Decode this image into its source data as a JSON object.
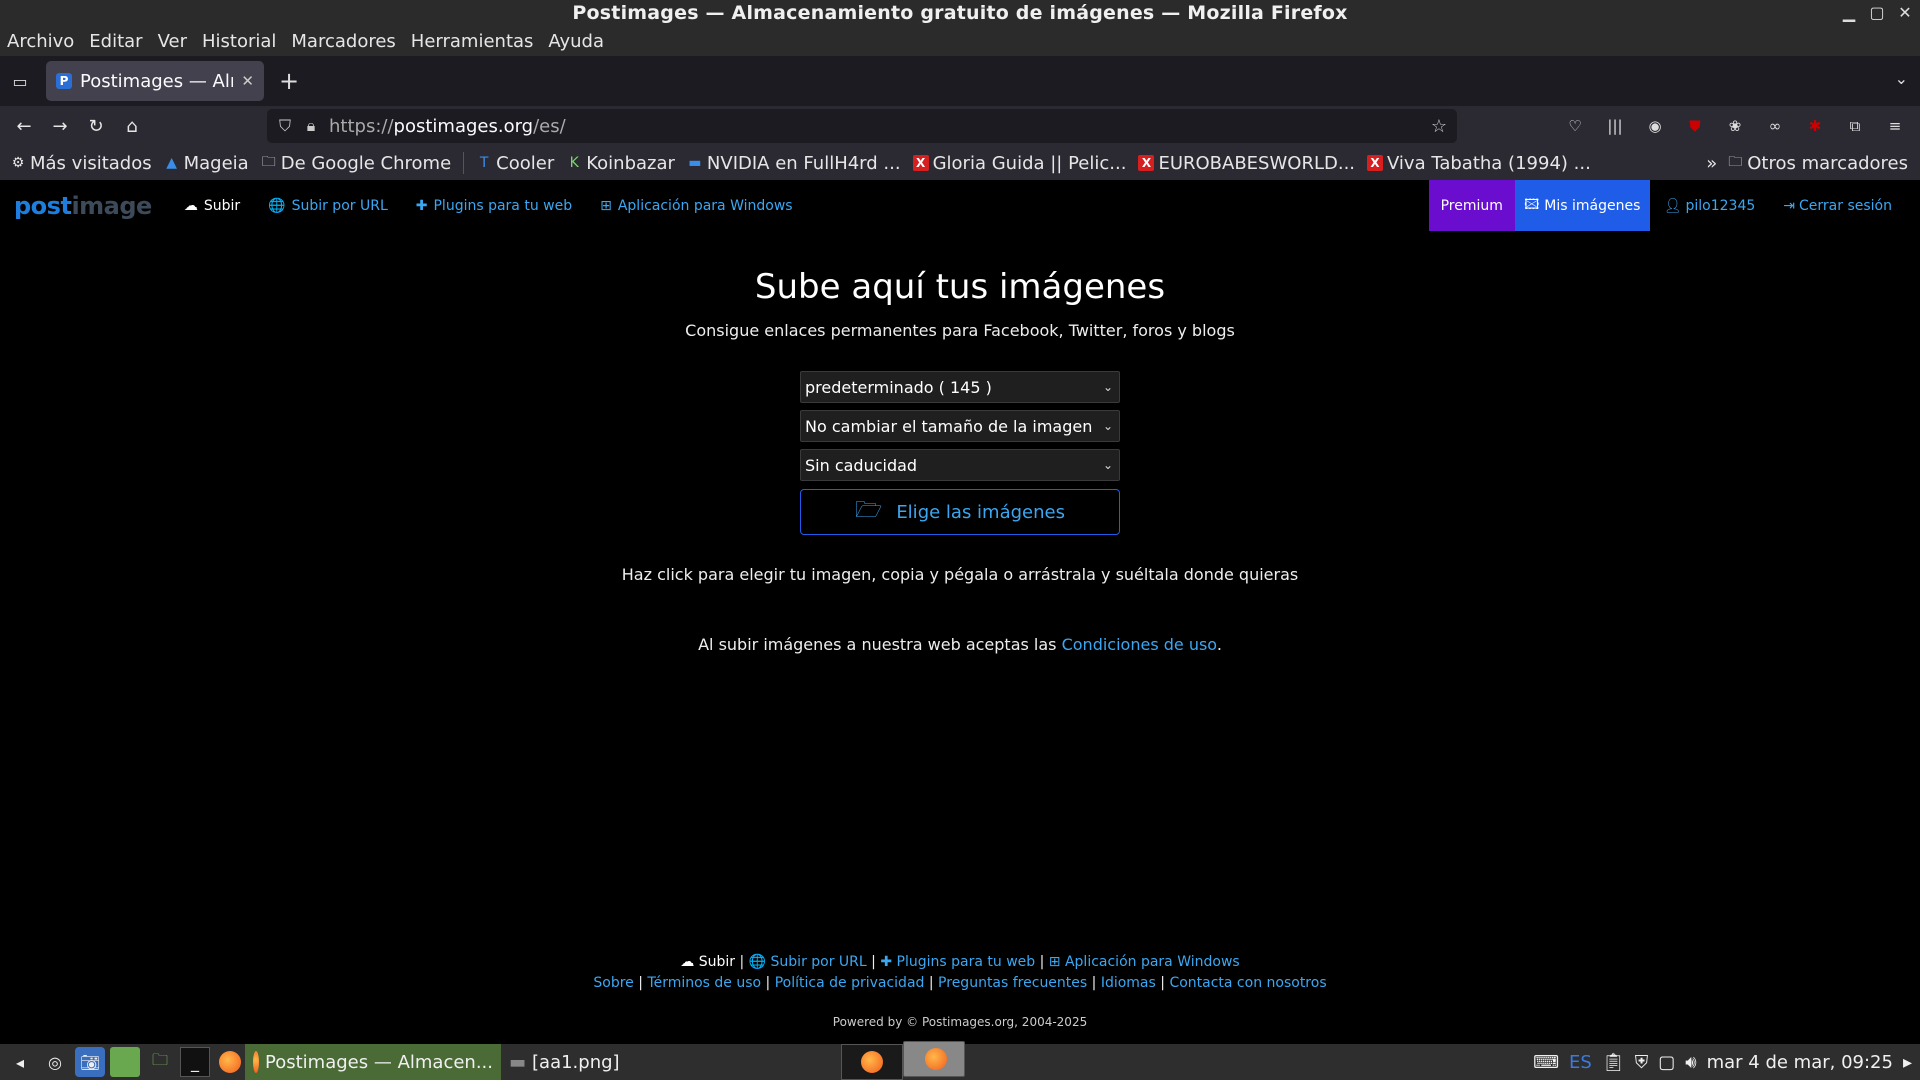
{
  "window": {
    "title": "Postimages — Almacenamiento gratuito de imágenes — Mozilla Firefox",
    "controls": [
      "▁",
      "▢",
      "✕"
    ]
  },
  "menu": [
    "Archivo",
    "Editar",
    "Ver",
    "Historial",
    "Marcadores",
    "Herramientas",
    "Ayuda"
  ],
  "tab": {
    "title": "Postimages — Alma",
    "favicon": "P"
  },
  "address": {
    "prefix": "https://",
    "host": "postimages.org",
    "path": "/es/"
  },
  "bookmarks": [
    {
      "icon": "⚙",
      "label": "Más visitados"
    },
    {
      "icon": "▲",
      "label": "Mageia"
    },
    {
      "icon": "🗀",
      "label": "De Google Chrome"
    },
    {
      "icon": "T",
      "label": "Cooler"
    },
    {
      "icon": "K",
      "label": "Koinbazar"
    },
    {
      "icon": "▬",
      "label": "NVIDIA en FullH4rd ..."
    },
    {
      "icon": "X",
      "label": "Gloria Guida || Pelic..."
    },
    {
      "icon": "X",
      "label": "EUROBABESWORLD..."
    },
    {
      "icon": "X",
      "label": "Viva Tabatha (1994) ..."
    }
  ],
  "bookmarks_other": "Otros marcadores",
  "site": {
    "logo_a": "post",
    "logo_b": "image",
    "nav": [
      {
        "icon": "☁",
        "label": "Subir"
      },
      {
        "icon": "🌐",
        "label": "Subir por URL"
      },
      {
        "icon": "✚",
        "label": "Plugins para tu web"
      },
      {
        "icon": "⊞",
        "label": "Aplicación para Windows"
      }
    ],
    "premium": "Premium",
    "mis_imagenes": "Mis imágenes",
    "user": "pilo12345",
    "logout": "Cerrar sesión"
  },
  "hero": {
    "title": "Sube aquí tus imágenes",
    "subtitle": "Consigue enlaces permanentes para Facebook, Twitter, foros y blogs"
  },
  "selects": {
    "gallery": "predeterminado ( 145 )",
    "resize": "No cambiar el tamaño de la imagen",
    "expiry": "Sin caducidad"
  },
  "choose_button": "Elige las imágenes",
  "hint": "Haz click para elegir tu imagen, copia y pégala o arrástrala y suéltala donde quieras",
  "terms": {
    "text": "Al subir imágenes a nuestra web aceptas las ",
    "link": "Condiciones de uso",
    "end": "."
  },
  "footer": {
    "links1": [
      {
        "icon": "☁",
        "label": "Subir"
      },
      {
        "icon": "🌐",
        "label": "Subir por URL"
      },
      {
        "icon": "✚",
        "label": "Plugins para tu web"
      },
      {
        "icon": "⊞",
        "label": "Aplicación para Windows"
      }
    ],
    "links2": [
      "Sobre",
      "Términos de uso",
      "Política de privacidad",
      "Preguntas frecuentes",
      "Idiomas",
      "Contacta con nosotros"
    ],
    "powered": "Powered by © Postimages.org, 2004-2025"
  },
  "taskbar": {
    "active_task": "Postimages — Almacen...",
    "other_task": "[aa1.png]",
    "lang": "ES",
    "clock": "mar  4 de mar, 09:25"
  }
}
